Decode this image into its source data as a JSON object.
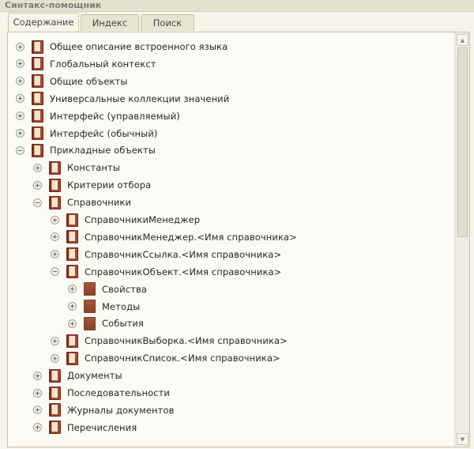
{
  "window": {
    "title": "Синтакс-помощник"
  },
  "tabs": [
    {
      "label": "Содержание",
      "active": true
    },
    {
      "label": "Индекс",
      "active": false
    },
    {
      "label": "Поиск",
      "active": false
    }
  ],
  "tree": [
    {
      "label": "Общее описание встроенного языка",
      "level": 0,
      "expander": "plus",
      "icon": "book-icon"
    },
    {
      "label": "Глобальный контекст",
      "level": 0,
      "expander": "plus",
      "icon": "book-icon"
    },
    {
      "label": "Общие объекты",
      "level": 0,
      "expander": "plus",
      "icon": "book-icon"
    },
    {
      "label": "Универсальные коллекции значений",
      "level": 0,
      "expander": "plus",
      "icon": "book-icon"
    },
    {
      "label": "Интерфейс (управляемый)",
      "level": 0,
      "expander": "plus",
      "icon": "book-icon"
    },
    {
      "label": "Интерфейс (обычный)",
      "level": 0,
      "expander": "plus",
      "icon": "book-icon"
    },
    {
      "label": "Прикладные объекты",
      "level": 0,
      "expander": "minus",
      "icon": "book-icon"
    },
    {
      "label": "Константы",
      "level": 1,
      "expander": "plus",
      "icon": "book-icon"
    },
    {
      "label": "Критерии отбора",
      "level": 1,
      "expander": "plus",
      "icon": "book-icon"
    },
    {
      "label": "Справочники",
      "level": 1,
      "expander": "minus",
      "icon": "book-icon"
    },
    {
      "label": "СправочникиМенеджер",
      "level": 2,
      "expander": "plus",
      "icon": "book-icon"
    },
    {
      "label": "СправочникМенеджер.<Имя справочника>",
      "level": 2,
      "expander": "plus",
      "icon": "book-icon"
    },
    {
      "label": "СправочникСсылка.<Имя справочника>",
      "level": 2,
      "expander": "plus",
      "icon": "book-icon"
    },
    {
      "label": "СправочникОбъект.<Имя справочника>",
      "level": 2,
      "expander": "minus",
      "icon": "book-icon"
    },
    {
      "label": "Свойства",
      "level": 3,
      "expander": "plus",
      "icon": "page-icon"
    },
    {
      "label": "Методы",
      "level": 3,
      "expander": "plus",
      "icon": "page-icon"
    },
    {
      "label": "События",
      "level": 3,
      "expander": "plus",
      "icon": "page-icon"
    },
    {
      "label": "СправочникВыборка.<Имя справочника>",
      "level": 2,
      "expander": "plus",
      "icon": "book-icon"
    },
    {
      "label": "СправочникСписок.<Имя справочника>",
      "level": 2,
      "expander": "plus",
      "icon": "book-icon"
    },
    {
      "label": "Документы",
      "level": 1,
      "expander": "plus",
      "icon": "book-icon"
    },
    {
      "label": "Последовательности",
      "level": 1,
      "expander": "plus",
      "icon": "book-icon"
    },
    {
      "label": "Журналы документов",
      "level": 1,
      "expander": "plus",
      "icon": "book-icon"
    },
    {
      "label": "Перечисления",
      "level": 1,
      "expander": "plus",
      "icon": "book-icon"
    }
  ]
}
